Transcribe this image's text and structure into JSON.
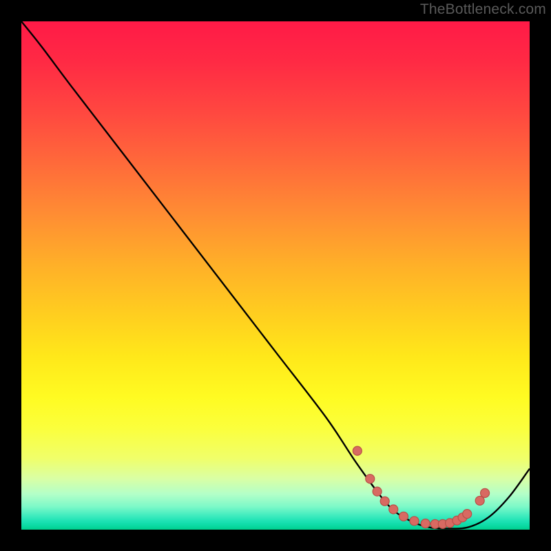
{
  "watermark": "TheBottleneck.com",
  "chart_data": {
    "type": "line",
    "title": "",
    "xlabel": "",
    "ylabel": "",
    "xlim": [
      0,
      100
    ],
    "ylim": [
      0,
      100
    ],
    "grid": false,
    "legend": false,
    "series": [
      {
        "name": "curve",
        "color": "#000000",
        "x": [
          0,
          4,
          10,
          20,
          30,
          40,
          50,
          60,
          66,
          72,
          76,
          80,
          84,
          88,
          92,
          96,
          100
        ],
        "y": [
          100,
          95,
          87,
          74,
          61,
          48,
          35,
          22,
          13,
          5,
          2,
          0.5,
          0.2,
          0.5,
          2.5,
          6.5,
          12
        ]
      }
    ],
    "markers": {
      "color": "#d86a62",
      "stroke": "#b84f47",
      "radius": 6.5,
      "points_frac": [
        {
          "x": 0.661,
          "y": 0.155
        },
        {
          "x": 0.686,
          "y": 0.1
        },
        {
          "x": 0.7,
          "y": 0.075
        },
        {
          "x": 0.715,
          "y": 0.056
        },
        {
          "x": 0.732,
          "y": 0.04
        },
        {
          "x": 0.752,
          "y": 0.026
        },
        {
          "x": 0.773,
          "y": 0.017
        },
        {
          "x": 0.795,
          "y": 0.012
        },
        {
          "x": 0.814,
          "y": 0.011
        },
        {
          "x": 0.829,
          "y": 0.011
        },
        {
          "x": 0.843,
          "y": 0.013
        },
        {
          "x": 0.857,
          "y": 0.018
        },
        {
          "x": 0.868,
          "y": 0.024
        },
        {
          "x": 0.877,
          "y": 0.031
        },
        {
          "x": 0.902,
          "y": 0.057
        },
        {
          "x": 0.912,
          "y": 0.072
        }
      ]
    }
  }
}
